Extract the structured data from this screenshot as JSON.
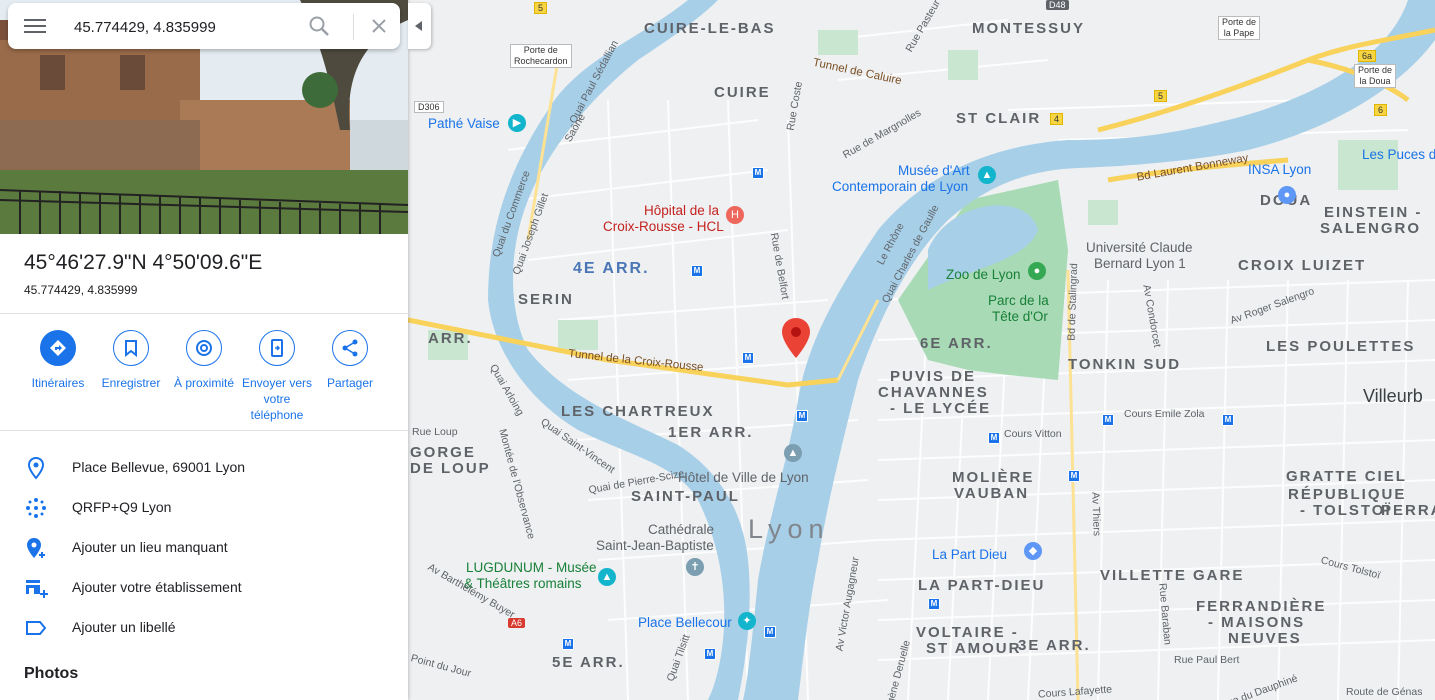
{
  "search": {
    "value": "45.774429, 4.835999"
  },
  "place": {
    "title": "45°46'27.9\"N 4°50'09.6\"E",
    "subtitle": "45.774429, 4.835999"
  },
  "actions": [
    {
      "label": "Itinéraires",
      "icon": "directions-icon"
    },
    {
      "label": "Enregistrer",
      "icon": "bookmark-icon"
    },
    {
      "label": "À proximité",
      "icon": "nearby-icon"
    },
    {
      "label": "Envoyer vers votre téléphone",
      "icon": "send-to-phone-icon"
    },
    {
      "label": "Partager",
      "icon": "share-icon"
    }
  ],
  "info": [
    {
      "text": "Place Bellevue, 69001 Lyon",
      "icon": "location-pin-icon"
    },
    {
      "text": "QRFP+Q9 Lyon",
      "icon": "plus-code-icon"
    },
    {
      "text": "Ajouter un lieu manquant",
      "icon": "add-place-icon"
    },
    {
      "text": "Ajouter votre établissement",
      "icon": "add-business-icon"
    },
    {
      "text": "Ajouter un libellé",
      "icon": "label-icon"
    }
  ],
  "photos_heading": "Photos",
  "colors": {
    "accent": "#1a73e8",
    "river": "#a7cfe8",
    "park": "#a8dab5",
    "marker": "#ea4335",
    "highway": "#f8d25b"
  },
  "map": {
    "districts": [
      "CUIRE-LE-BAS",
      "MONTESSUY",
      "CUIRE",
      "ST CLAIR",
      "DOUA",
      "EINSTEIN -",
      "SALENGRO",
      "SERIN",
      "CROIX LUIZET",
      "ARR.",
      "6E ARR.",
      "TONKIN SUD",
      "LES POULETTES",
      "PUVIS DE",
      "CHAVANNES",
      "- LE LYCÉE",
      "LES CHARTREUX",
      "1ER ARR.",
      "GORGE",
      "DE LOUP",
      "MOLIÈRE",
      "VAUBAN",
      "GRATTE CIEL",
      "RÉPUBLIQUE",
      "- TOLSTOÏ",
      "PERRAL",
      "SAINT-PAUL",
      "LA PART-DIEU",
      "VILLETTE GARE",
      "FERRANDIÈRE",
      "- MAISONS",
      "NEUVES",
      "VOLTAIRE -",
      "ST AMOUR",
      "3E ARR.",
      "5E ARR."
    ],
    "blue_districts": [
      "4E ARR."
    ],
    "city": "Lyon",
    "edge_city": "Villeurb",
    "pois_blue": [
      "Pathé Vaise",
      "Musée d'Art",
      "Contemporain de Lyon",
      "INSA Lyon",
      "Les Puces d",
      "Hôtel de Ville de Lyon",
      "Cathédrale",
      "Saint-Jean-Baptiste",
      "La Part Dieu",
      "Place Bellecour"
    ],
    "pois_red": [
      "Hôpital de la",
      "Croix-Rousse - HCL"
    ],
    "pois_green": [
      "Zoo de Lyon",
      "Parc de la",
      "Tête d'Or",
      "LUGDUNUM - Musée",
      "& Théâtres romains"
    ],
    "pois_dark": [
      "Université Claude",
      "Bernard Lyon 1"
    ],
    "streets_brown": [
      "Tunnel de Caluire",
      "Bd Laurent Bonneway",
      "Tunnel de la Croix-Rousse"
    ],
    "streets": [
      "Quai Paul Sédallian",
      "Quai du Commerce",
      "Quai Joseph Gillet",
      "Saône",
      "Rue Coste",
      "Rue de Margnolles",
      "Rue Pasteur",
      "Quai Charles de Gaulle",
      "Le Rhône",
      "Rue de Belfort",
      "Bd de Stalingrad",
      "Av Condorcet",
      "Av Roger Salengro",
      "Cours Emile Zola",
      "Cours Vitton",
      "Av Thiers",
      "Quai Arloing",
      "Quai Saint-Vincent",
      "Quai de Pierre-Scize",
      "Montée de l'Observance",
      "Rue Loup",
      "Av Barthélémy Buyer",
      "Av Victor Augagneur",
      "Quai Tilsitt",
      "Rue Paul Bert",
      "Rue Baraban",
      "Cours Tolstoï",
      "Route de Génas",
      "Cours Lafayette",
      "Rue du Dauphiné",
      "Point du Jour",
      "Bd Eugène Deruelle"
    ],
    "route_shields_white": [
      "Porte de",
      "Rochecardon",
      "Porte de",
      "la Pape",
      "Porte de",
      "la Doua",
      "D306"
    ],
    "route_shields_yellow": [
      "5",
      "5",
      "4",
      "6",
      "6a"
    ],
    "route_shields_red": [
      "A6"
    ],
    "route_shields_dark": [
      "D48"
    ],
    "side_labels": [
      "aise",
      "RE"
    ]
  }
}
